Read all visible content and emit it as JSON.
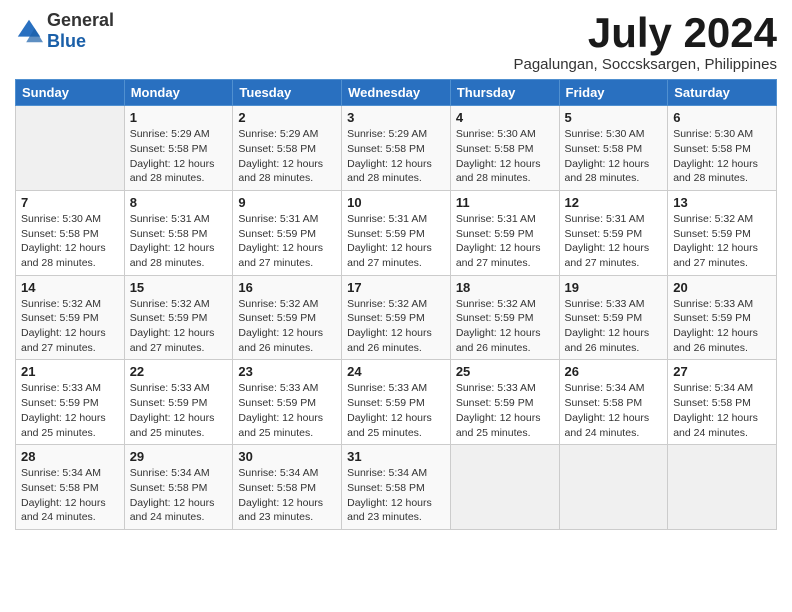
{
  "logo": {
    "general": "General",
    "blue": "Blue"
  },
  "title": {
    "month": "July 2024",
    "location": "Pagalungan, Soccsksargen, Philippines"
  },
  "weekdays": [
    "Sunday",
    "Monday",
    "Tuesday",
    "Wednesday",
    "Thursday",
    "Friday",
    "Saturday"
  ],
  "weeks": [
    [
      {
        "day": "",
        "info": ""
      },
      {
        "day": "1",
        "info": "Sunrise: 5:29 AM\nSunset: 5:58 PM\nDaylight: 12 hours\nand 28 minutes."
      },
      {
        "day": "2",
        "info": "Sunrise: 5:29 AM\nSunset: 5:58 PM\nDaylight: 12 hours\nand 28 minutes."
      },
      {
        "day": "3",
        "info": "Sunrise: 5:29 AM\nSunset: 5:58 PM\nDaylight: 12 hours\nand 28 minutes."
      },
      {
        "day": "4",
        "info": "Sunrise: 5:30 AM\nSunset: 5:58 PM\nDaylight: 12 hours\nand 28 minutes."
      },
      {
        "day": "5",
        "info": "Sunrise: 5:30 AM\nSunset: 5:58 PM\nDaylight: 12 hours\nand 28 minutes."
      },
      {
        "day": "6",
        "info": "Sunrise: 5:30 AM\nSunset: 5:58 PM\nDaylight: 12 hours\nand 28 minutes."
      }
    ],
    [
      {
        "day": "7",
        "info": "Sunrise: 5:30 AM\nSunset: 5:58 PM\nDaylight: 12 hours\nand 28 minutes."
      },
      {
        "day": "8",
        "info": "Sunrise: 5:31 AM\nSunset: 5:58 PM\nDaylight: 12 hours\nand 28 minutes."
      },
      {
        "day": "9",
        "info": "Sunrise: 5:31 AM\nSunset: 5:59 PM\nDaylight: 12 hours\nand 27 minutes."
      },
      {
        "day": "10",
        "info": "Sunrise: 5:31 AM\nSunset: 5:59 PM\nDaylight: 12 hours\nand 27 minutes."
      },
      {
        "day": "11",
        "info": "Sunrise: 5:31 AM\nSunset: 5:59 PM\nDaylight: 12 hours\nand 27 minutes."
      },
      {
        "day": "12",
        "info": "Sunrise: 5:31 AM\nSunset: 5:59 PM\nDaylight: 12 hours\nand 27 minutes."
      },
      {
        "day": "13",
        "info": "Sunrise: 5:32 AM\nSunset: 5:59 PM\nDaylight: 12 hours\nand 27 minutes."
      }
    ],
    [
      {
        "day": "14",
        "info": "Sunrise: 5:32 AM\nSunset: 5:59 PM\nDaylight: 12 hours\nand 27 minutes."
      },
      {
        "day": "15",
        "info": "Sunrise: 5:32 AM\nSunset: 5:59 PM\nDaylight: 12 hours\nand 27 minutes."
      },
      {
        "day": "16",
        "info": "Sunrise: 5:32 AM\nSunset: 5:59 PM\nDaylight: 12 hours\nand 26 minutes."
      },
      {
        "day": "17",
        "info": "Sunrise: 5:32 AM\nSunset: 5:59 PM\nDaylight: 12 hours\nand 26 minutes."
      },
      {
        "day": "18",
        "info": "Sunrise: 5:32 AM\nSunset: 5:59 PM\nDaylight: 12 hours\nand 26 minutes."
      },
      {
        "day": "19",
        "info": "Sunrise: 5:33 AM\nSunset: 5:59 PM\nDaylight: 12 hours\nand 26 minutes."
      },
      {
        "day": "20",
        "info": "Sunrise: 5:33 AM\nSunset: 5:59 PM\nDaylight: 12 hours\nand 26 minutes."
      }
    ],
    [
      {
        "day": "21",
        "info": "Sunrise: 5:33 AM\nSunset: 5:59 PM\nDaylight: 12 hours\nand 25 minutes."
      },
      {
        "day": "22",
        "info": "Sunrise: 5:33 AM\nSunset: 5:59 PM\nDaylight: 12 hours\nand 25 minutes."
      },
      {
        "day": "23",
        "info": "Sunrise: 5:33 AM\nSunset: 5:59 PM\nDaylight: 12 hours\nand 25 minutes."
      },
      {
        "day": "24",
        "info": "Sunrise: 5:33 AM\nSunset: 5:59 PM\nDaylight: 12 hours\nand 25 minutes."
      },
      {
        "day": "25",
        "info": "Sunrise: 5:33 AM\nSunset: 5:59 PM\nDaylight: 12 hours\nand 25 minutes."
      },
      {
        "day": "26",
        "info": "Sunrise: 5:34 AM\nSunset: 5:58 PM\nDaylight: 12 hours\nand 24 minutes."
      },
      {
        "day": "27",
        "info": "Sunrise: 5:34 AM\nSunset: 5:58 PM\nDaylight: 12 hours\nand 24 minutes."
      }
    ],
    [
      {
        "day": "28",
        "info": "Sunrise: 5:34 AM\nSunset: 5:58 PM\nDaylight: 12 hours\nand 24 minutes."
      },
      {
        "day": "29",
        "info": "Sunrise: 5:34 AM\nSunset: 5:58 PM\nDaylight: 12 hours\nand 24 minutes."
      },
      {
        "day": "30",
        "info": "Sunrise: 5:34 AM\nSunset: 5:58 PM\nDaylight: 12 hours\nand 23 minutes."
      },
      {
        "day": "31",
        "info": "Sunrise: 5:34 AM\nSunset: 5:58 PM\nDaylight: 12 hours\nand 23 minutes."
      },
      {
        "day": "",
        "info": ""
      },
      {
        "day": "",
        "info": ""
      },
      {
        "day": "",
        "info": ""
      }
    ]
  ]
}
